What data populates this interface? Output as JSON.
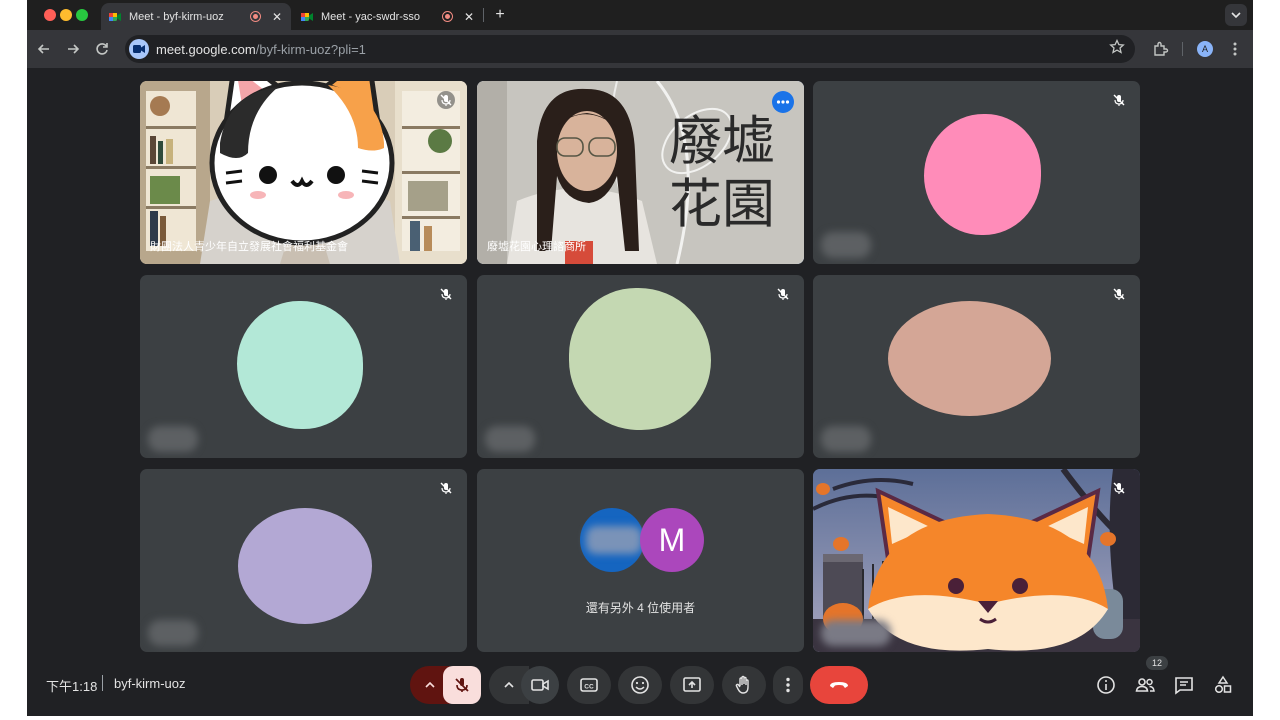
{
  "browser": {
    "tabs": [
      {
        "title": "Meet - byf-kirm-uoz",
        "active": true
      },
      {
        "title": "Meet - yac-swdr-sso",
        "active": false
      }
    ],
    "new_tab_label": "+",
    "tab_close": "✕",
    "url_host": "meet.google.com",
    "url_path": "/byf-kirm-uoz?pli=1",
    "profile_initial": "A"
  },
  "meeting": {
    "time": "下午1:18",
    "code": "byf-kirm-uoz",
    "participant_count": "12",
    "tiles": [
      {
        "name": "財團法人青少年自立發展社會福利基金會",
        "muted": true,
        "avatar": "cat-sticker"
      },
      {
        "name": "廢墟花園心理諮商所",
        "muted": false,
        "speaking": true,
        "background_text_1": "廢墟",
        "background_text_2": "花園"
      },
      {
        "name": "",
        "muted": true,
        "avatar_color": "#ff8cb9"
      },
      {
        "name": "",
        "muted": true,
        "avatar_color": "#b3e8d7"
      },
      {
        "name": "",
        "muted": true,
        "avatar_color": "#c4d8b2"
      },
      {
        "name": "",
        "muted": true,
        "avatar_color": "#d4a696"
      },
      {
        "name": "",
        "muted": true,
        "avatar_color": "#b3a8d4"
      },
      {
        "name": "還有另外 4 位使用者",
        "others_initial": "M",
        "others_colors": [
          "#1565c0",
          "#ab47bc"
        ]
      },
      {
        "name": "",
        "muted": true,
        "avatar": "fox-sticker"
      }
    ]
  },
  "colors": {
    "end_call": "#e8453c",
    "mic_off_bg": "#f9dedc",
    "mic_chevron_bg": "#601410",
    "accent": "#8ab4f8"
  }
}
